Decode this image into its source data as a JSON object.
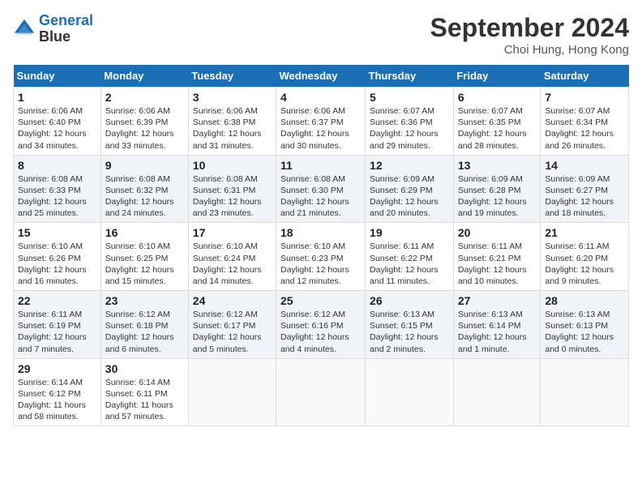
{
  "header": {
    "logo_line1": "General",
    "logo_line2": "Blue",
    "month": "September 2024",
    "location": "Choi Hung, Hong Kong"
  },
  "weekdays": [
    "Sunday",
    "Monday",
    "Tuesday",
    "Wednesday",
    "Thursday",
    "Friday",
    "Saturday"
  ],
  "weeks": [
    [
      {
        "day": "1",
        "sunrise": "6:06 AM",
        "sunset": "6:40 PM",
        "daylight": "12 hours and 34 minutes."
      },
      {
        "day": "2",
        "sunrise": "6:06 AM",
        "sunset": "6:39 PM",
        "daylight": "12 hours and 33 minutes."
      },
      {
        "day": "3",
        "sunrise": "6:06 AM",
        "sunset": "6:38 PM",
        "daylight": "12 hours and 31 minutes."
      },
      {
        "day": "4",
        "sunrise": "6:06 AM",
        "sunset": "6:37 PM",
        "daylight": "12 hours and 30 minutes."
      },
      {
        "day": "5",
        "sunrise": "6:07 AM",
        "sunset": "6:36 PM",
        "daylight": "12 hours and 29 minutes."
      },
      {
        "day": "6",
        "sunrise": "6:07 AM",
        "sunset": "6:35 PM",
        "daylight": "12 hours and 28 minutes."
      },
      {
        "day": "7",
        "sunrise": "6:07 AM",
        "sunset": "6:34 PM",
        "daylight": "12 hours and 26 minutes."
      }
    ],
    [
      {
        "day": "8",
        "sunrise": "6:08 AM",
        "sunset": "6:33 PM",
        "daylight": "12 hours and 25 minutes."
      },
      {
        "day": "9",
        "sunrise": "6:08 AM",
        "sunset": "6:32 PM",
        "daylight": "12 hours and 24 minutes."
      },
      {
        "day": "10",
        "sunrise": "6:08 AM",
        "sunset": "6:31 PM",
        "daylight": "12 hours and 23 minutes."
      },
      {
        "day": "11",
        "sunrise": "6:08 AM",
        "sunset": "6:30 PM",
        "daylight": "12 hours and 21 minutes."
      },
      {
        "day": "12",
        "sunrise": "6:09 AM",
        "sunset": "6:29 PM",
        "daylight": "12 hours and 20 minutes."
      },
      {
        "day": "13",
        "sunrise": "6:09 AM",
        "sunset": "6:28 PM",
        "daylight": "12 hours and 19 minutes."
      },
      {
        "day": "14",
        "sunrise": "6:09 AM",
        "sunset": "6:27 PM",
        "daylight": "12 hours and 18 minutes."
      }
    ],
    [
      {
        "day": "15",
        "sunrise": "6:10 AM",
        "sunset": "6:26 PM",
        "daylight": "12 hours and 16 minutes."
      },
      {
        "day": "16",
        "sunrise": "6:10 AM",
        "sunset": "6:25 PM",
        "daylight": "12 hours and 15 minutes."
      },
      {
        "day": "17",
        "sunrise": "6:10 AM",
        "sunset": "6:24 PM",
        "daylight": "12 hours and 14 minutes."
      },
      {
        "day": "18",
        "sunrise": "6:10 AM",
        "sunset": "6:23 PM",
        "daylight": "12 hours and 12 minutes."
      },
      {
        "day": "19",
        "sunrise": "6:11 AM",
        "sunset": "6:22 PM",
        "daylight": "12 hours and 11 minutes."
      },
      {
        "day": "20",
        "sunrise": "6:11 AM",
        "sunset": "6:21 PM",
        "daylight": "12 hours and 10 minutes."
      },
      {
        "day": "21",
        "sunrise": "6:11 AM",
        "sunset": "6:20 PM",
        "daylight": "12 hours and 9 minutes."
      }
    ],
    [
      {
        "day": "22",
        "sunrise": "6:11 AM",
        "sunset": "6:19 PM",
        "daylight": "12 hours and 7 minutes."
      },
      {
        "day": "23",
        "sunrise": "6:12 AM",
        "sunset": "6:18 PM",
        "daylight": "12 hours and 6 minutes."
      },
      {
        "day": "24",
        "sunrise": "6:12 AM",
        "sunset": "6:17 PM",
        "daylight": "12 hours and 5 minutes."
      },
      {
        "day": "25",
        "sunrise": "6:12 AM",
        "sunset": "6:16 PM",
        "daylight": "12 hours and 4 minutes."
      },
      {
        "day": "26",
        "sunrise": "6:13 AM",
        "sunset": "6:15 PM",
        "daylight": "12 hours and 2 minutes."
      },
      {
        "day": "27",
        "sunrise": "6:13 AM",
        "sunset": "6:14 PM",
        "daylight": "12 hours and 1 minute."
      },
      {
        "day": "28",
        "sunrise": "6:13 AM",
        "sunset": "6:13 PM",
        "daylight": "12 hours and 0 minutes."
      }
    ],
    [
      {
        "day": "29",
        "sunrise": "6:14 AM",
        "sunset": "6:12 PM",
        "daylight": "11 hours and 58 minutes."
      },
      {
        "day": "30",
        "sunrise": "6:14 AM",
        "sunset": "6:11 PM",
        "daylight": "11 hours and 57 minutes."
      },
      null,
      null,
      null,
      null,
      null
    ]
  ]
}
